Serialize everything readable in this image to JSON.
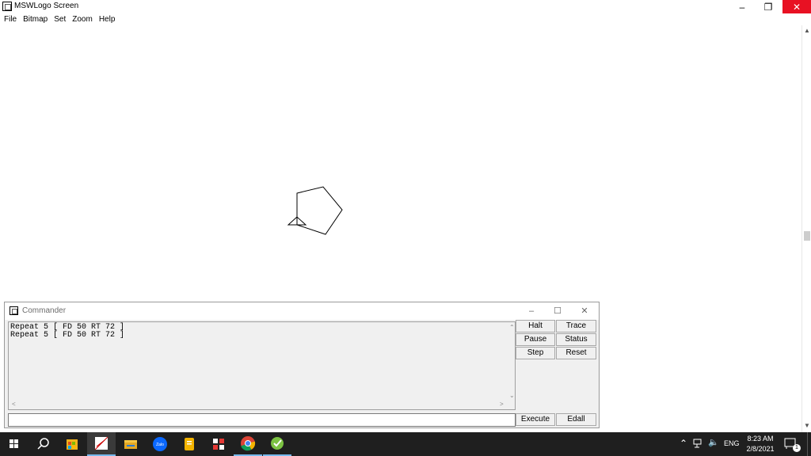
{
  "window": {
    "title": "MSWLogo Screen",
    "minimize_icon": "minimize-icon",
    "restore_icon": "restore-icon",
    "close_icon": "close-icon"
  },
  "menu": [
    "File",
    "Bitmap",
    "Set",
    "Zoom",
    "Help"
  ],
  "canvas": {
    "drawing": "pentagon",
    "turtle": "turtle-triangle"
  },
  "commander": {
    "title": "Commander",
    "history": [
      "Repeat 5 [ FD 50 RT 72 ]",
      "Repeat 5 [ FD 50 RT 72 ]"
    ],
    "input_value": "",
    "buttons": {
      "halt": "Halt",
      "trace": "Trace",
      "pause": "Pause",
      "status": "Status",
      "step": "Step",
      "reset": "Reset",
      "execute": "Execute",
      "edall": "Edall"
    }
  },
  "taskbar": {
    "time": "8:23 AM",
    "date": "2/8/2021",
    "language": "ENG",
    "notification_count": "1",
    "apps": [
      "windows-start-icon",
      "search-icon",
      "store-icon",
      "mswlogo-icon",
      "file-explorer-icon",
      "zalo-icon",
      "notes-icon",
      "app-icon",
      "chrome-icon",
      "greenshot-icon"
    ],
    "zalo_label": "Zalo",
    "colors": {
      "background": "#1f1f1f",
      "active_underline": "#76b9ed"
    }
  }
}
